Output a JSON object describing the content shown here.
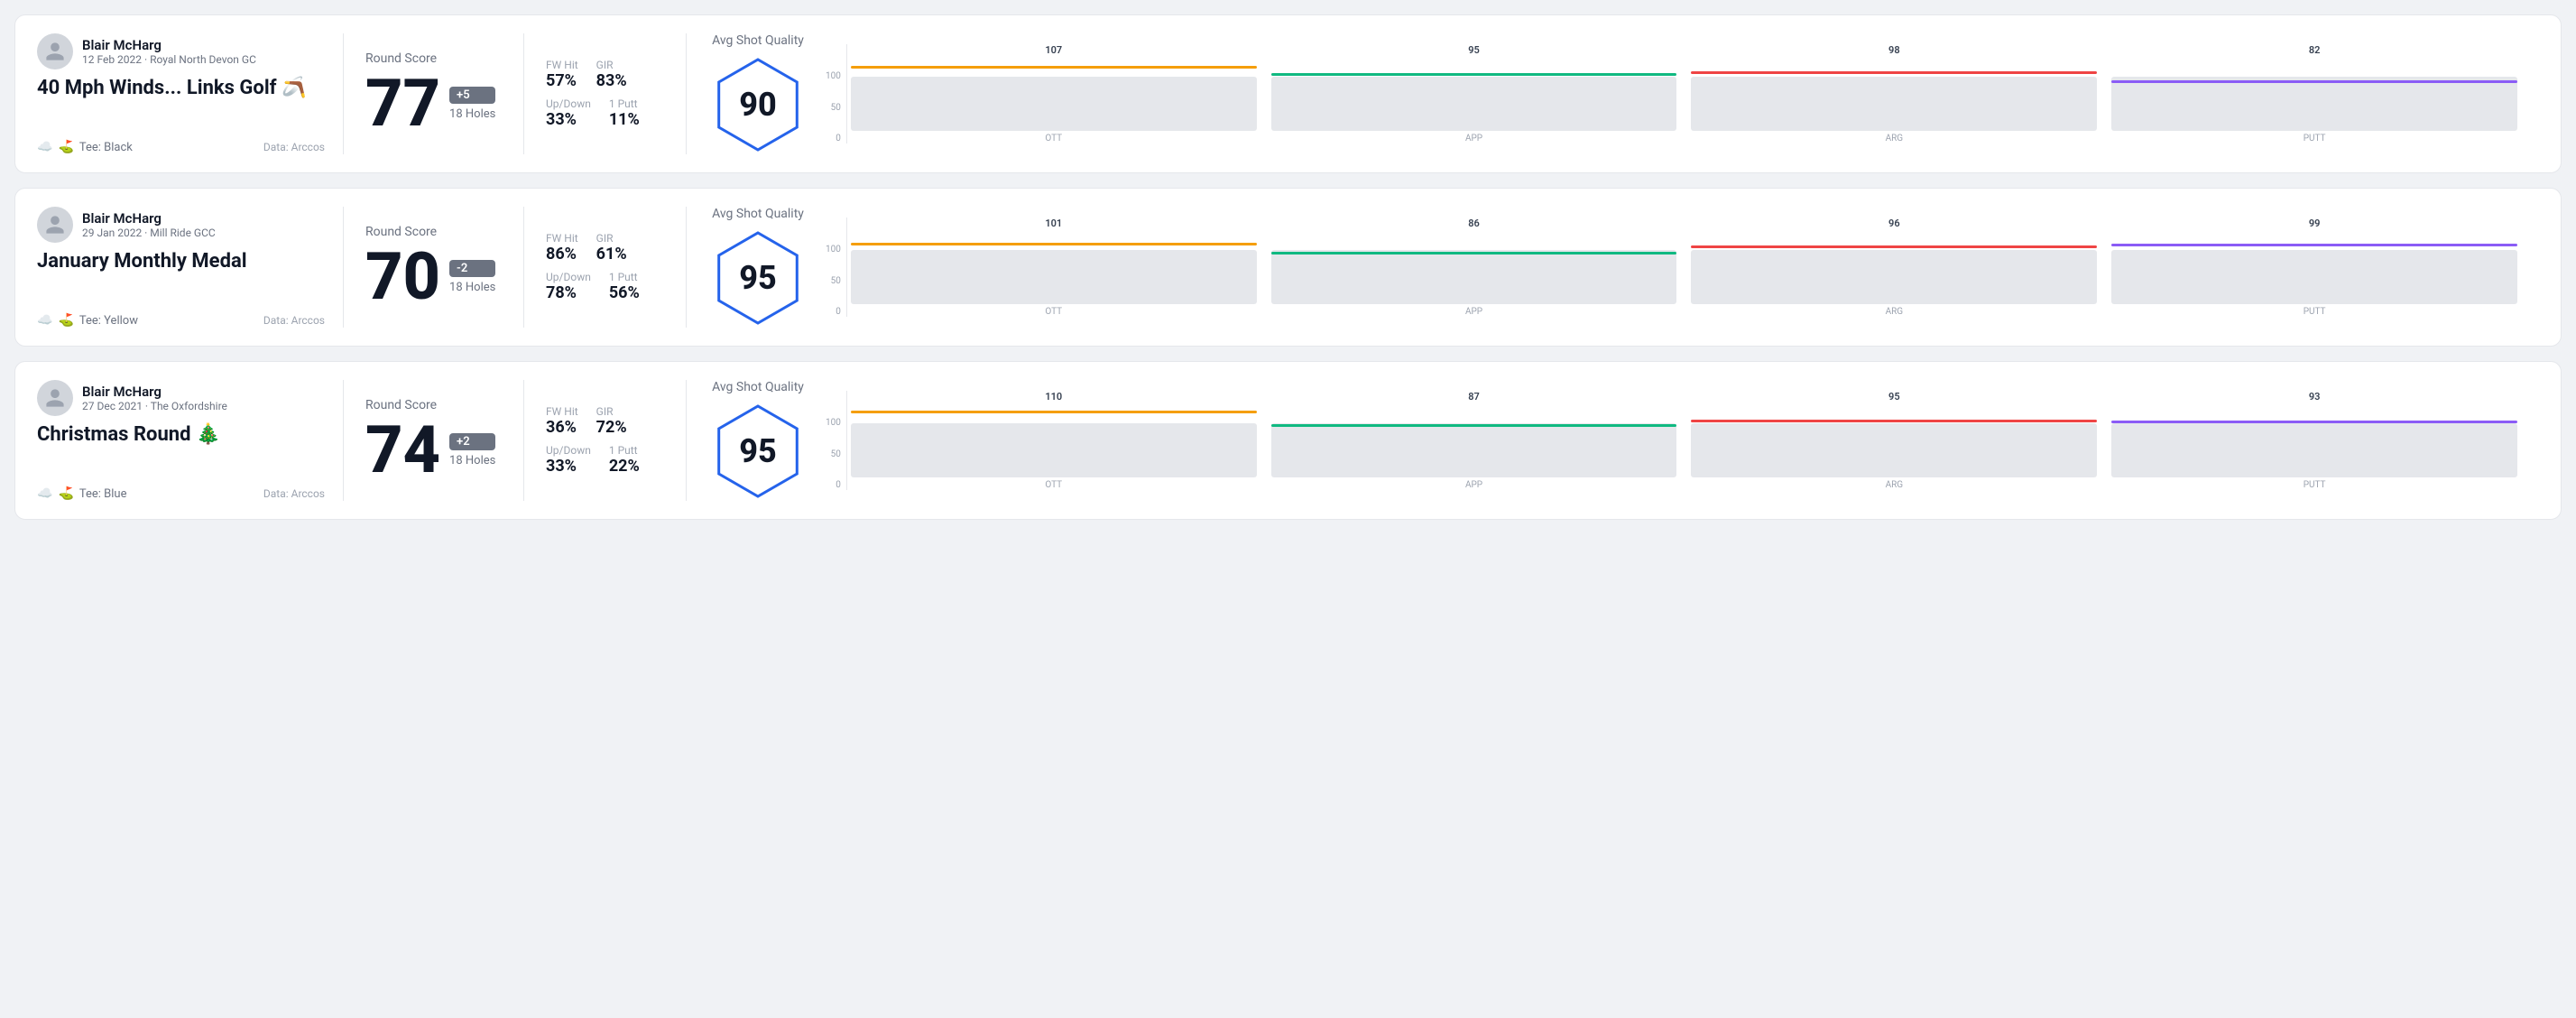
{
  "rounds": [
    {
      "id": "round1",
      "user": {
        "name": "Blair McHarg",
        "date": "12 Feb 2022",
        "course": "Royal North Devon GC"
      },
      "title": "40 Mph Winds... Links Golf 🪃",
      "tee": "Black",
      "dataSource": "Data: Arccos",
      "score": {
        "value": "77",
        "modifier": "+5",
        "modifierType": "over",
        "holes": "18 Holes"
      },
      "stats": {
        "fwHitLabel": "FW Hit",
        "fwHitValue": "57%",
        "girLabel": "GIR",
        "girValue": "83%",
        "upDownLabel": "Up/Down",
        "upDownValue": "33%",
        "onePuttLabel": "1 Putt",
        "onePuttValue": "11%"
      },
      "quality": {
        "label": "Avg Shot Quality",
        "score": "90",
        "bars": [
          {
            "label": "OTT",
            "value": 107,
            "color": "#f59e0b",
            "barHeight": 70,
            "markerColor": "#f59e0b"
          },
          {
            "label": "APP",
            "value": 95,
            "color": "#10b981",
            "barHeight": 60,
            "markerColor": "#10b981"
          },
          {
            "label": "ARG",
            "value": 98,
            "color": "#ef4444",
            "barHeight": 62,
            "markerColor": "#ef4444"
          },
          {
            "label": "PUTT",
            "value": 82,
            "color": "#8b5cf6",
            "barHeight": 52,
            "markerColor": "#8b5cf6"
          }
        ]
      }
    },
    {
      "id": "round2",
      "user": {
        "name": "Blair McHarg",
        "date": "29 Jan 2022",
        "course": "Mill Ride GCC"
      },
      "title": "January Monthly Medal",
      "tee": "Yellow",
      "dataSource": "Data: Arccos",
      "score": {
        "value": "70",
        "modifier": "-2",
        "modifierType": "under",
        "holes": "18 Holes"
      },
      "stats": {
        "fwHitLabel": "FW Hit",
        "fwHitValue": "86%",
        "girLabel": "GIR",
        "girValue": "61%",
        "upDownLabel": "Up/Down",
        "upDownValue": "78%",
        "onePuttLabel": "1 Putt",
        "onePuttValue": "56%"
      },
      "quality": {
        "label": "Avg Shot Quality",
        "score": "95",
        "bars": [
          {
            "label": "OTT",
            "value": 101,
            "color": "#f59e0b",
            "barHeight": 65,
            "markerColor": "#f59e0b"
          },
          {
            "label": "APP",
            "value": 86,
            "color": "#10b981",
            "barHeight": 55,
            "markerColor": "#10b981"
          },
          {
            "label": "ARG",
            "value": 96,
            "color": "#ef4444",
            "barHeight": 62,
            "markerColor": "#ef4444"
          },
          {
            "label": "PUTT",
            "value": 99,
            "color": "#8b5cf6",
            "barHeight": 64,
            "markerColor": "#8b5cf6"
          }
        ]
      }
    },
    {
      "id": "round3",
      "user": {
        "name": "Blair McHarg",
        "date": "27 Dec 2021",
        "course": "The Oxfordshire"
      },
      "title": "Christmas Round 🎄",
      "tee": "Blue",
      "dataSource": "Data: Arccos",
      "score": {
        "value": "74",
        "modifier": "+2",
        "modifierType": "over",
        "holes": "18 Holes"
      },
      "stats": {
        "fwHitLabel": "FW Hit",
        "fwHitValue": "36%",
        "girLabel": "GIR",
        "girValue": "72%",
        "upDownLabel": "Up/Down",
        "upDownValue": "33%",
        "onePuttLabel": "1 Putt",
        "onePuttValue": "22%"
      },
      "quality": {
        "label": "Avg Shot Quality",
        "score": "95",
        "bars": [
          {
            "label": "OTT",
            "value": 110,
            "color": "#f59e0b",
            "barHeight": 72,
            "markerColor": "#f59e0b"
          },
          {
            "label": "APP",
            "value": 87,
            "color": "#10b981",
            "barHeight": 56,
            "markerColor": "#10b981"
          },
          {
            "label": "ARG",
            "value": 95,
            "color": "#ef4444",
            "barHeight": 62,
            "markerColor": "#ef4444"
          },
          {
            "label": "PUTT",
            "value": 93,
            "color": "#8b5cf6",
            "barHeight": 60,
            "markerColor": "#8b5cf6"
          }
        ]
      }
    }
  ]
}
